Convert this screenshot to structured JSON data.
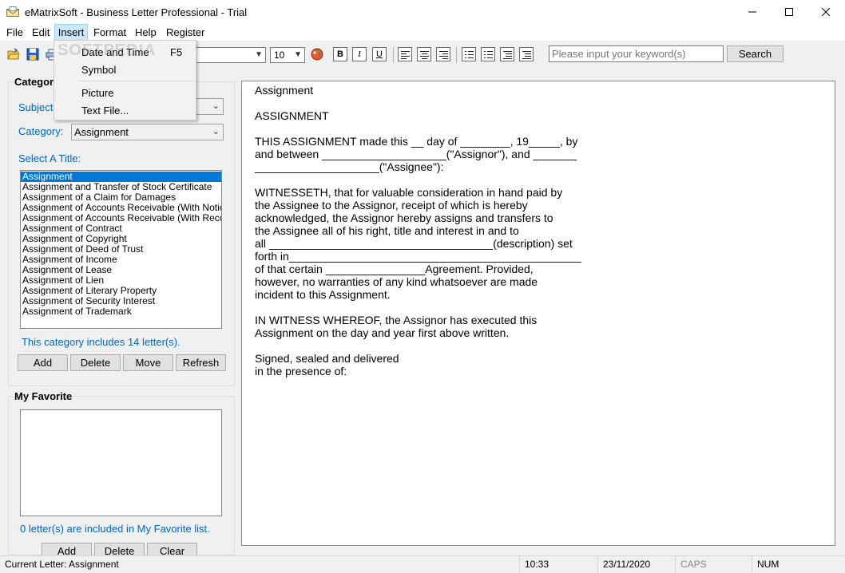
{
  "window": {
    "title": "eMatrixSoft - Business Letter Professional - Trial",
    "icon": "envelope-icon"
  },
  "menu": {
    "items": [
      "File",
      "Edit",
      "Insert",
      "Format",
      "Help",
      "Register"
    ],
    "active": "Insert"
  },
  "insert_menu": {
    "items": [
      {
        "label": "Date and Time",
        "shortcut": "F5"
      },
      {
        "label": "Symbol",
        "shortcut": ""
      },
      {
        "label": "Picture",
        "shortcut": ""
      },
      {
        "label": "Text File...",
        "shortcut": ""
      }
    ]
  },
  "toolbar": {
    "font_size": "10",
    "format_buttons": [
      "B",
      "I",
      "U"
    ],
    "search_placeholder": "Please input your keyword(s)",
    "search_label": "Search"
  },
  "category_panel": {
    "title": "Category",
    "subject_label": "Subject:",
    "category_label": "Category:",
    "category_value": "Assignment",
    "select_title_label": "Select A Title:",
    "titles": [
      "Assignment",
      "Assignment and Transfer of Stock Certificate",
      "Assignment of a Claim for Damages",
      "Assignment of Accounts Receivable (With Notice)",
      "Assignment of Accounts Receivable (With Recourse)",
      "Assignment of Contract",
      "Assignment of Copyright",
      "Assignment of Deed of Trust",
      "Assignment of Income",
      "Assignment of Lease",
      "Assignment of Lien",
      "Assignment of Literary Property",
      "Assignment of Security Interest",
      "Assignment of Trademark"
    ],
    "selected_index": 0,
    "count_text": "This category includes 14 letter(s).",
    "buttons": [
      "Add",
      "Delete",
      "Move",
      "Refresh"
    ]
  },
  "favorite_panel": {
    "title": "My Favorite",
    "count_text": "0 letter(s) are included in My Favorite list.",
    "buttons": [
      "Add",
      "Delete",
      "Clear"
    ]
  },
  "document": {
    "lines": [
      "Assignment",
      "",
      "ASSIGNMENT",
      "",
      "THIS ASSIGNMENT made this __ day of ________, 19_____, by",
      "and between ____________________(\"Assignor\"), and _______",
      "____________________(\"Assignee\"):",
      "",
      "WITNESSETH, that for valuable consideration in hand paid by",
      "the Assignee to the Assignor, receipt of which is hereby",
      "acknowledged, the Assignor hereby assigns and transfers to",
      "the Assignee all of his right, title and interest in and to",
      "all ____________________________________(description) set",
      "forth in_______________________________________________",
      "of that certain ________________Agreement. Provided,",
      "however, no warranties of any kind whatsoever are made",
      "incident to this Assignment.",
      "",
      "IN WITNESS WHEREOF, the Assignor has executed this",
      "Assignment on the day and year first above written.",
      "",
      "Signed, sealed and delivered",
      "in the presence of:"
    ]
  },
  "status": {
    "current_letter": "Current Letter: Assignment",
    "time": "10:33",
    "date": "23/11/2020",
    "caps": "CAPS",
    "num": "NUM"
  },
  "watermark": "SOFTPEDIA"
}
